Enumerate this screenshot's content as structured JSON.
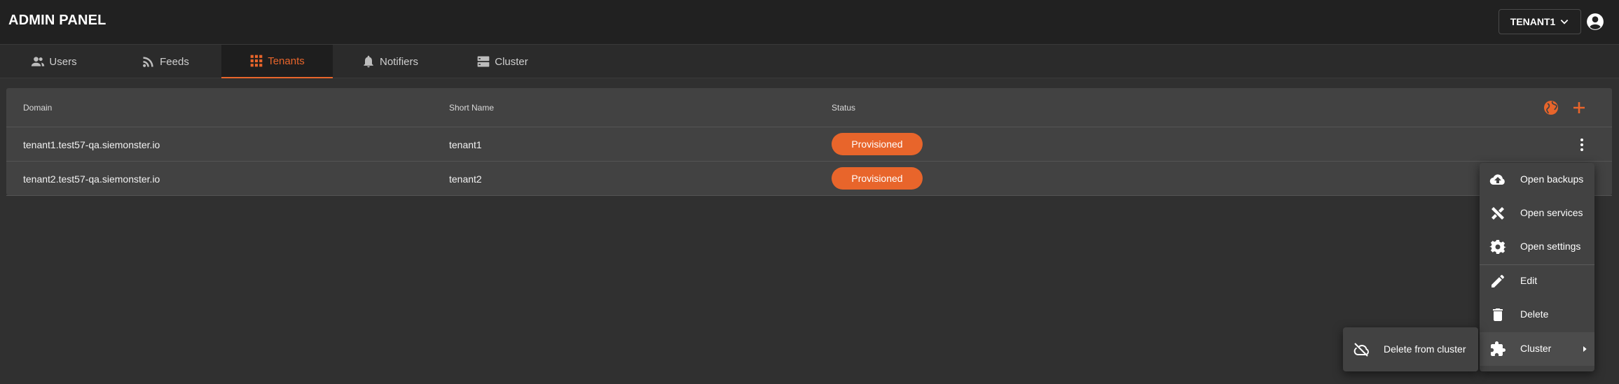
{
  "app": {
    "title": "ADMIN PANEL",
    "tenant_selected": "TENANT1"
  },
  "colors": {
    "accent": "#e8652b",
    "appbar": "#212121",
    "background": "#303030",
    "card": "#424242"
  },
  "tabs": [
    {
      "label": "Users",
      "icon": "users-icon"
    },
    {
      "label": "Feeds",
      "icon": "rss-feed-icon"
    },
    {
      "label": "Tenants",
      "icon": "grid-icon",
      "active": true
    },
    {
      "label": "Notifiers",
      "icon": "bell-icon"
    },
    {
      "label": "Cluster",
      "icon": "server-icon"
    }
  ],
  "table": {
    "columns": [
      "Domain",
      "Short Name",
      "Status"
    ],
    "rows": [
      {
        "domain": "tenant1.test57-qa.siemonster.io",
        "short_name": "tenant1",
        "status": "Provisioned"
      },
      {
        "domain": "tenant2.test57-qa.siemonster.io",
        "short_name": "tenant2",
        "status": "Provisioned"
      }
    ]
  },
  "context_menu": {
    "items": [
      {
        "label": "Open backups",
        "icon": "cloud-upload-icon"
      },
      {
        "label": "Open services",
        "icon": "tools-icon"
      },
      {
        "label": "Open settings",
        "icon": "gear-icon"
      },
      {
        "label": "Edit",
        "icon": "pencil-icon"
      },
      {
        "label": "Delete",
        "icon": "trash-icon"
      },
      {
        "label": "Cluster",
        "icon": "puzzle-icon"
      }
    ],
    "submenu": [
      {
        "label": "Delete from cluster",
        "icon": "cloud-off-icon"
      }
    ]
  }
}
